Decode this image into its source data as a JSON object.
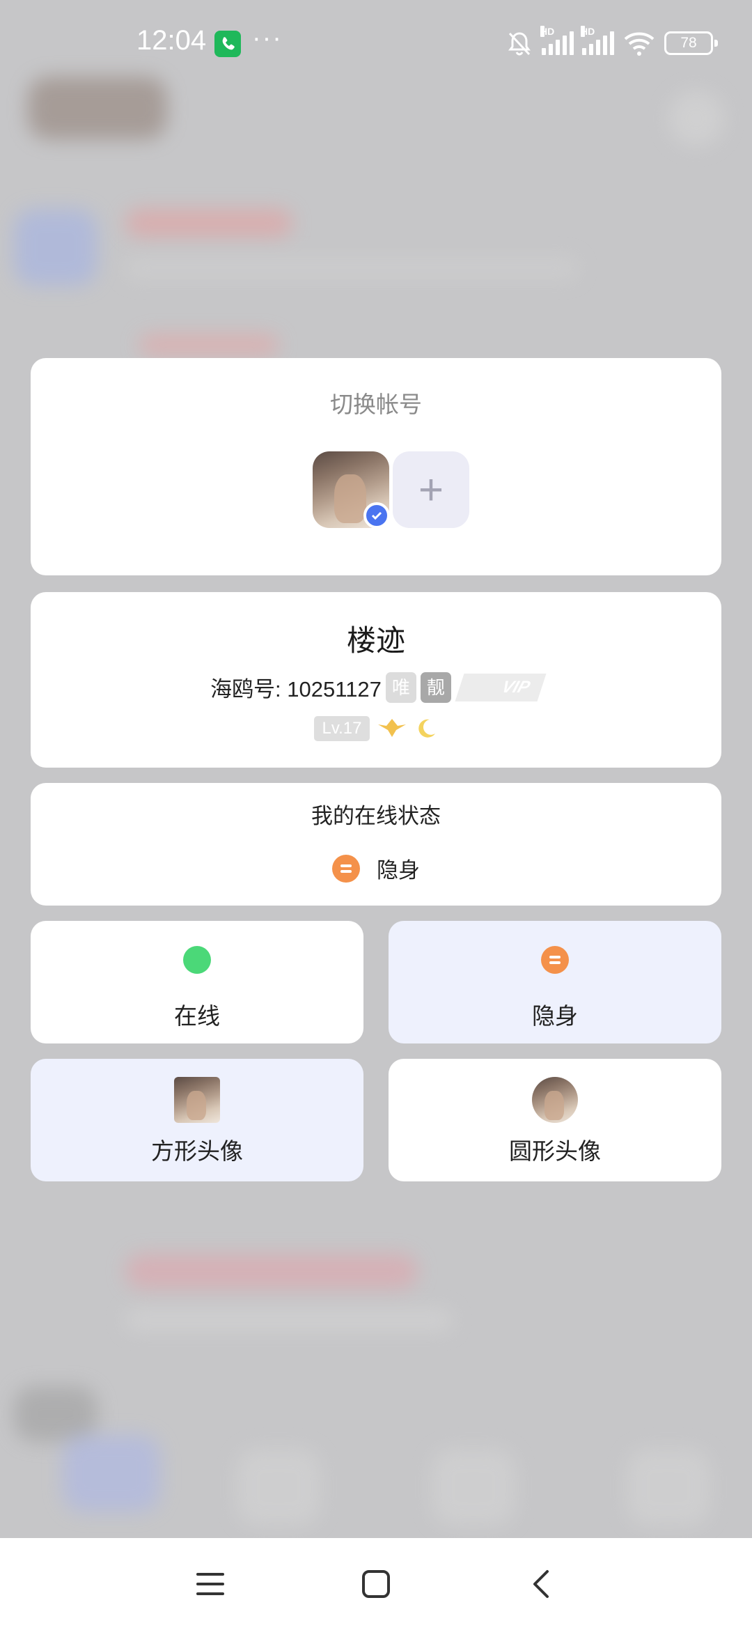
{
  "status_bar": {
    "time": "12:04",
    "more": "···",
    "hd1": "HD",
    "hd2": "HD",
    "battery": "78"
  },
  "switch_account": {
    "title": "切换帐号",
    "add_symbol": "+"
  },
  "profile": {
    "nickname": "楼迹",
    "id_line": "海鸥号: 10251127",
    "tag1": "唯",
    "tag2": "靓",
    "vip": "VIP",
    "level": "Lv.17"
  },
  "online_status": {
    "heading": "我的在线状态",
    "current": "隐身"
  },
  "options": {
    "online": "在线",
    "stealth": "隐身",
    "square_avatar": "方形头像",
    "round_avatar": "圆形头像"
  },
  "colors": {
    "accent_blue": "#4a74f0",
    "online_green": "#4bd878",
    "stealth_orange": "#f4914a",
    "selected_bg": "#eef1fd"
  }
}
